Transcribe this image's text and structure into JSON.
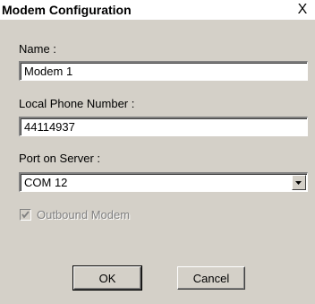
{
  "window": {
    "title": "Modem Configuration",
    "close_label": "X"
  },
  "fields": {
    "name_label": "Name :",
    "name_value": "Modem 1",
    "phone_label": "Local Phone Number :",
    "phone_value": "44114937",
    "port_label": "Port on Server :",
    "port_value": "COM 12"
  },
  "checkbox": {
    "label": "Outbound Modem",
    "checked": true,
    "enabled": false
  },
  "buttons": {
    "ok_label": "OK",
    "cancel_label": "Cancel"
  },
  "colors": {
    "dialog_bg": "#d4d0c8",
    "disabled_text": "#808080"
  }
}
